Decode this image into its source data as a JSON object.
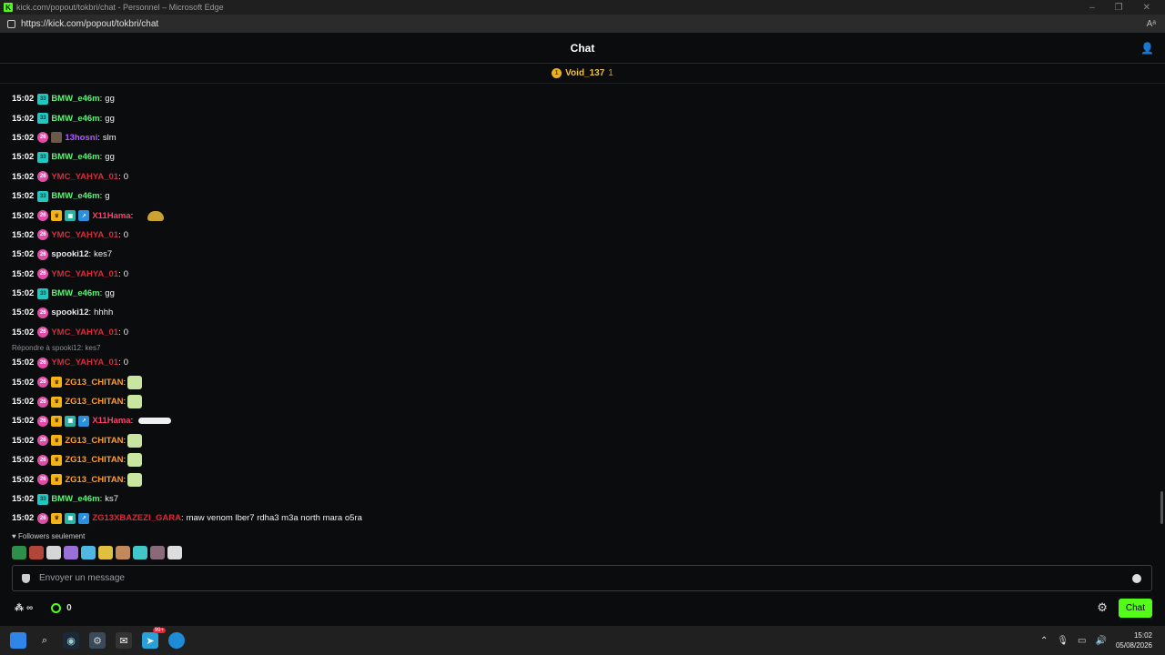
{
  "window": {
    "title": "kick.com/popout/tokbri/chat - Personnel – Microsoft Edge",
    "url": "https://kick.com/popout/tokbri/chat"
  },
  "header": {
    "title": "Chat"
  },
  "pinned": {
    "name": "Void_137",
    "count": "1"
  },
  "messages": [
    {
      "time": "15:02",
      "badges": [
        "cyan"
      ],
      "user": "BMW_e46m",
      "color": "green",
      "text": "gg"
    },
    {
      "time": "15:02",
      "badges": [
        "cyan"
      ],
      "user": "BMW_e46m",
      "color": "green",
      "text": "gg"
    },
    {
      "time": "15:02",
      "badges": [
        "pink",
        "avatar"
      ],
      "user": "13hosni",
      "color": "purple",
      "text": "slm"
    },
    {
      "time": "15:02",
      "badges": [
        "cyan"
      ],
      "user": "BMW_e46m",
      "color": "green",
      "text": "gg"
    },
    {
      "time": "15:02",
      "badges": [
        "pink"
      ],
      "user": "YMC_YAHYA_01",
      "color": "red",
      "text": "0"
    },
    {
      "time": "15:02",
      "badges": [
        "cyan"
      ],
      "user": "BMW_e46m",
      "color": "green",
      "text": "g"
    },
    {
      "time": "15:02",
      "badges": [
        "pink",
        "crown",
        "tv",
        "arrow"
      ],
      "user": "X11Hama",
      "color": "pink",
      "text": "",
      "emote": "burger"
    },
    {
      "time": "15:02",
      "badges": [
        "pink"
      ],
      "user": "YMC_YAHYA_01",
      "color": "red",
      "text": "0"
    },
    {
      "time": "15:02",
      "badges": [
        "pink"
      ],
      "user": "spooki12",
      "color": "white",
      "text": "kes7"
    },
    {
      "time": "15:02",
      "badges": [
        "pink"
      ],
      "user": "YMC_YAHYA_01",
      "color": "red",
      "text": "0"
    },
    {
      "time": "15:02",
      "badges": [
        "cyan"
      ],
      "user": "BMW_e46m",
      "color": "green",
      "text": "gg"
    },
    {
      "time": "15:02",
      "badges": [
        "pink"
      ],
      "user": "spooki12",
      "color": "white",
      "text": "hhhh"
    },
    {
      "time": "15:02",
      "badges": [
        "pink"
      ],
      "user": "YMC_YAHYA_01",
      "color": "red",
      "text": "0"
    },
    {
      "reply": "Répondre à spooki12: kes7"
    },
    {
      "time": "15:02",
      "badges": [
        "pink"
      ],
      "user": "YMC_YAHYA_01",
      "color": "red",
      "text": "0"
    },
    {
      "time": "15:02",
      "badges": [
        "pink",
        "crown"
      ],
      "user": "ZG13_CHITAN",
      "color": "orange",
      "text": "",
      "emote": "cup"
    },
    {
      "time": "15:02",
      "badges": [
        "pink",
        "crown"
      ],
      "user": "ZG13_CHITAN",
      "color": "orange",
      "text": "",
      "emote": "cup"
    },
    {
      "time": "15:02",
      "badges": [
        "pink",
        "crown",
        "tv",
        "arrow"
      ],
      "user": "X11Hama",
      "color": "pink",
      "text": "",
      "emote": "snake"
    },
    {
      "time": "15:02",
      "badges": [
        "pink",
        "crown"
      ],
      "user": "ZG13_CHITAN",
      "color": "orange",
      "text": "",
      "emote": "cup"
    },
    {
      "time": "15:02",
      "badges": [
        "pink",
        "crown"
      ],
      "user": "ZG13_CHITAN",
      "color": "orange",
      "text": "",
      "emote": "cup"
    },
    {
      "time": "15:02",
      "badges": [
        "pink",
        "crown"
      ],
      "user": "ZG13_CHITAN",
      "color": "orange",
      "text": "",
      "emote": "cup"
    },
    {
      "time": "15:02",
      "badges": [
        "cyan"
      ],
      "user": "BMW_e46m",
      "color": "green",
      "text": "ks7"
    },
    {
      "time": "15:02",
      "badges": [
        "pink",
        "crown",
        "tv",
        "arrow"
      ],
      "user": "ZG13XBAZEZI_GARA",
      "color": "red",
      "text": "maw venom lber7 rdha3 m3a north mara o5ra"
    }
  ],
  "badge_labels": {
    "cyan": "33",
    "pink": "26"
  },
  "footer": {
    "followers_only": "Followers seulement",
    "input_placeholder": "Envoyer un message",
    "infinity": "∞",
    "points": "0",
    "chat_button": "Chat"
  },
  "emote_bar_colors": [
    "#2c8f4a",
    "#b0463a",
    "#d6d6d6",
    "#9a6fd8",
    "#4fb8e0",
    "#e0c040",
    "#c28a5a",
    "#41c6c9",
    "#8a6a7a",
    "#dddddd"
  ],
  "taskbar": {
    "time": "15:02",
    "date": "05/08/2026",
    "notification_badge": "99+"
  },
  "colors": {
    "accent": "#53fc18",
    "background": "#0b0c0d"
  }
}
